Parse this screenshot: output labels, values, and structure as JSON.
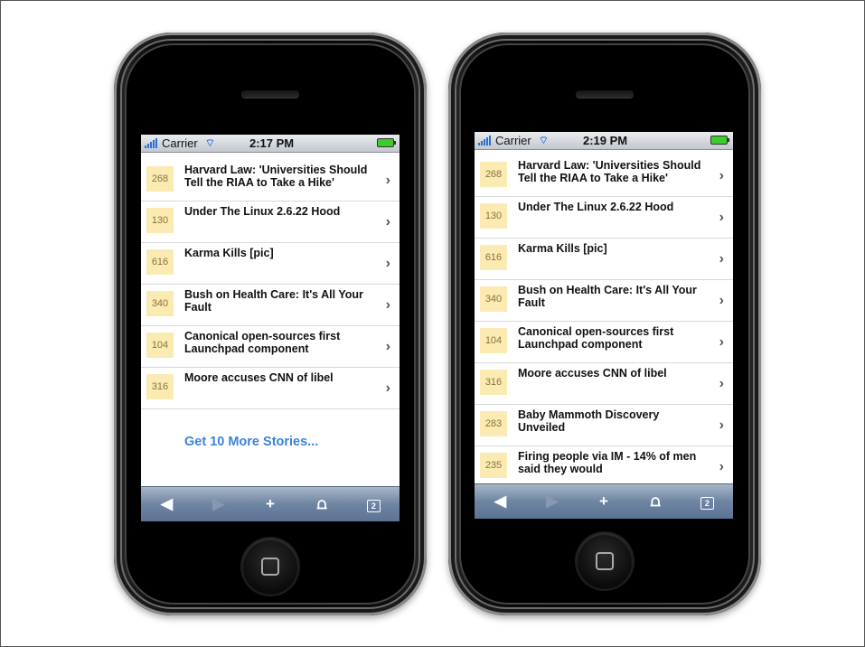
{
  "phones": [
    {
      "status": {
        "carrier": "Carrier",
        "time": "2:17 PM"
      },
      "stories": [
        {
          "score": "268",
          "title": "Harvard Law: 'Universities Should Tell the RIAA to Take a Hike'"
        },
        {
          "score": "130",
          "title": "Under The Linux 2.6.22 Hood"
        },
        {
          "score": "616",
          "title": "Karma Kills [pic]"
        },
        {
          "score": "340",
          "title": "Bush on Health Care: It's All Your Fault"
        },
        {
          "score": "104",
          "title": "Canonical open-sources first Launchpad component"
        },
        {
          "score": "316",
          "title": "Moore accuses CNN of libel"
        }
      ],
      "more_label": "Get 10 More Stories...",
      "toolbar": {
        "back": "◀",
        "forward": "▶",
        "add": "+",
        "bookmarks": "⩍",
        "tabs_count": "2"
      }
    },
    {
      "status": {
        "carrier": "Carrier",
        "time": "2:19 PM"
      },
      "stories": [
        {
          "score": "268",
          "title": "Harvard Law: 'Universities Should Tell the RIAA to Take a Hike'"
        },
        {
          "score": "130",
          "title": "Under The Linux 2.6.22 Hood"
        },
        {
          "score": "616",
          "title": "Karma Kills [pic]"
        },
        {
          "score": "340",
          "title": "Bush on Health Care: It's All Your Fault"
        },
        {
          "score": "104",
          "title": "Canonical open-sources first Launchpad component"
        },
        {
          "score": "316",
          "title": "Moore accuses CNN of libel"
        },
        {
          "score": "283",
          "title": "Baby Mammoth Discovery Unveiled"
        },
        {
          "score": "235",
          "title": "Firing people via IM - 14% of men said they would"
        }
      ],
      "toolbar": {
        "back": "◀",
        "forward": "▶",
        "add": "+",
        "bookmarks": "⩍",
        "tabs_count": "2"
      }
    }
  ],
  "colors": {
    "score_bg": "#fbeab2",
    "link": "#3a83d8",
    "toolbar": "#6e84a2",
    "battery": "#3ecb2d"
  }
}
